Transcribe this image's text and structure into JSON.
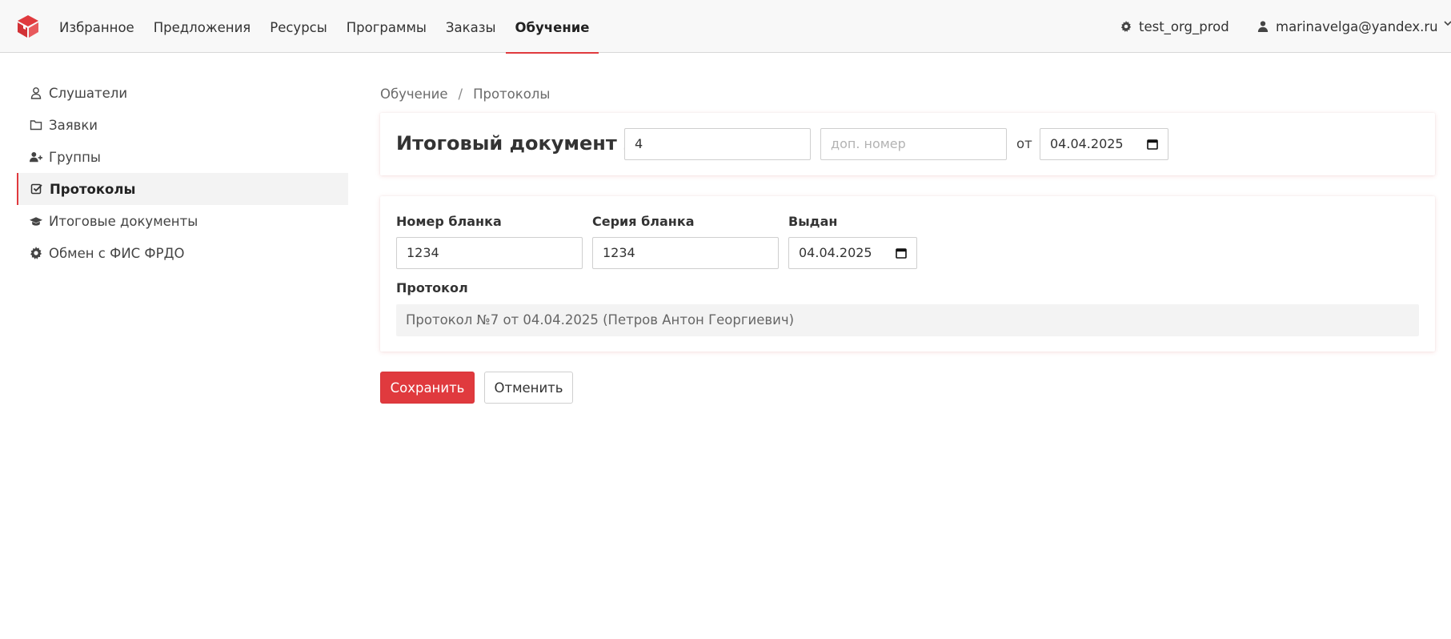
{
  "header": {
    "nav": [
      {
        "label": "Избранное"
      },
      {
        "label": "Предложения"
      },
      {
        "label": "Ресурсы"
      },
      {
        "label": "Программы"
      },
      {
        "label": "Заказы"
      },
      {
        "label": "Обучение",
        "active": true
      }
    ],
    "org": "test_org_prod",
    "user": "marinavelga@yandex.ru"
  },
  "sidebar": {
    "items": [
      {
        "label": "Слушатели",
        "icon": "user-icon"
      },
      {
        "label": "Заявки",
        "icon": "folder-icon"
      },
      {
        "label": "Группы",
        "icon": "user-plus-icon"
      },
      {
        "label": "Протоколы",
        "icon": "check-square-icon",
        "active": true
      },
      {
        "label": "Итоговые документы",
        "icon": "graduation-cap-icon"
      },
      {
        "label": "Обмен с ФИС ФРДО",
        "icon": "gear-icon"
      }
    ]
  },
  "breadcrumb": {
    "items": [
      "Обучение",
      "Протоколы"
    ],
    "separator": "/"
  },
  "document": {
    "title": "Итоговый документ №",
    "number_value": "4",
    "extra_number_placeholder": "доп. номер",
    "from_label": "от",
    "date_value": "04.04.2025"
  },
  "form": {
    "blank_number_label": "Номер бланка",
    "blank_number_value": "1234",
    "blank_series_label": "Серия бланка",
    "blank_series_value": "1234",
    "issued_label": "Выдан",
    "issued_value": "04.04.2025",
    "protocol_label": "Протокол",
    "protocol_value": "Протокол №7 от 04.04.2025 (Петров Антон Георгиевич)"
  },
  "actions": {
    "save_label": "Сохранить",
    "cancel_label": "Отменить"
  },
  "colors": {
    "accent": "#e03a3e",
    "navbar_bg": "#f8f8f8",
    "readonly_bg": "#f3f3f3"
  }
}
